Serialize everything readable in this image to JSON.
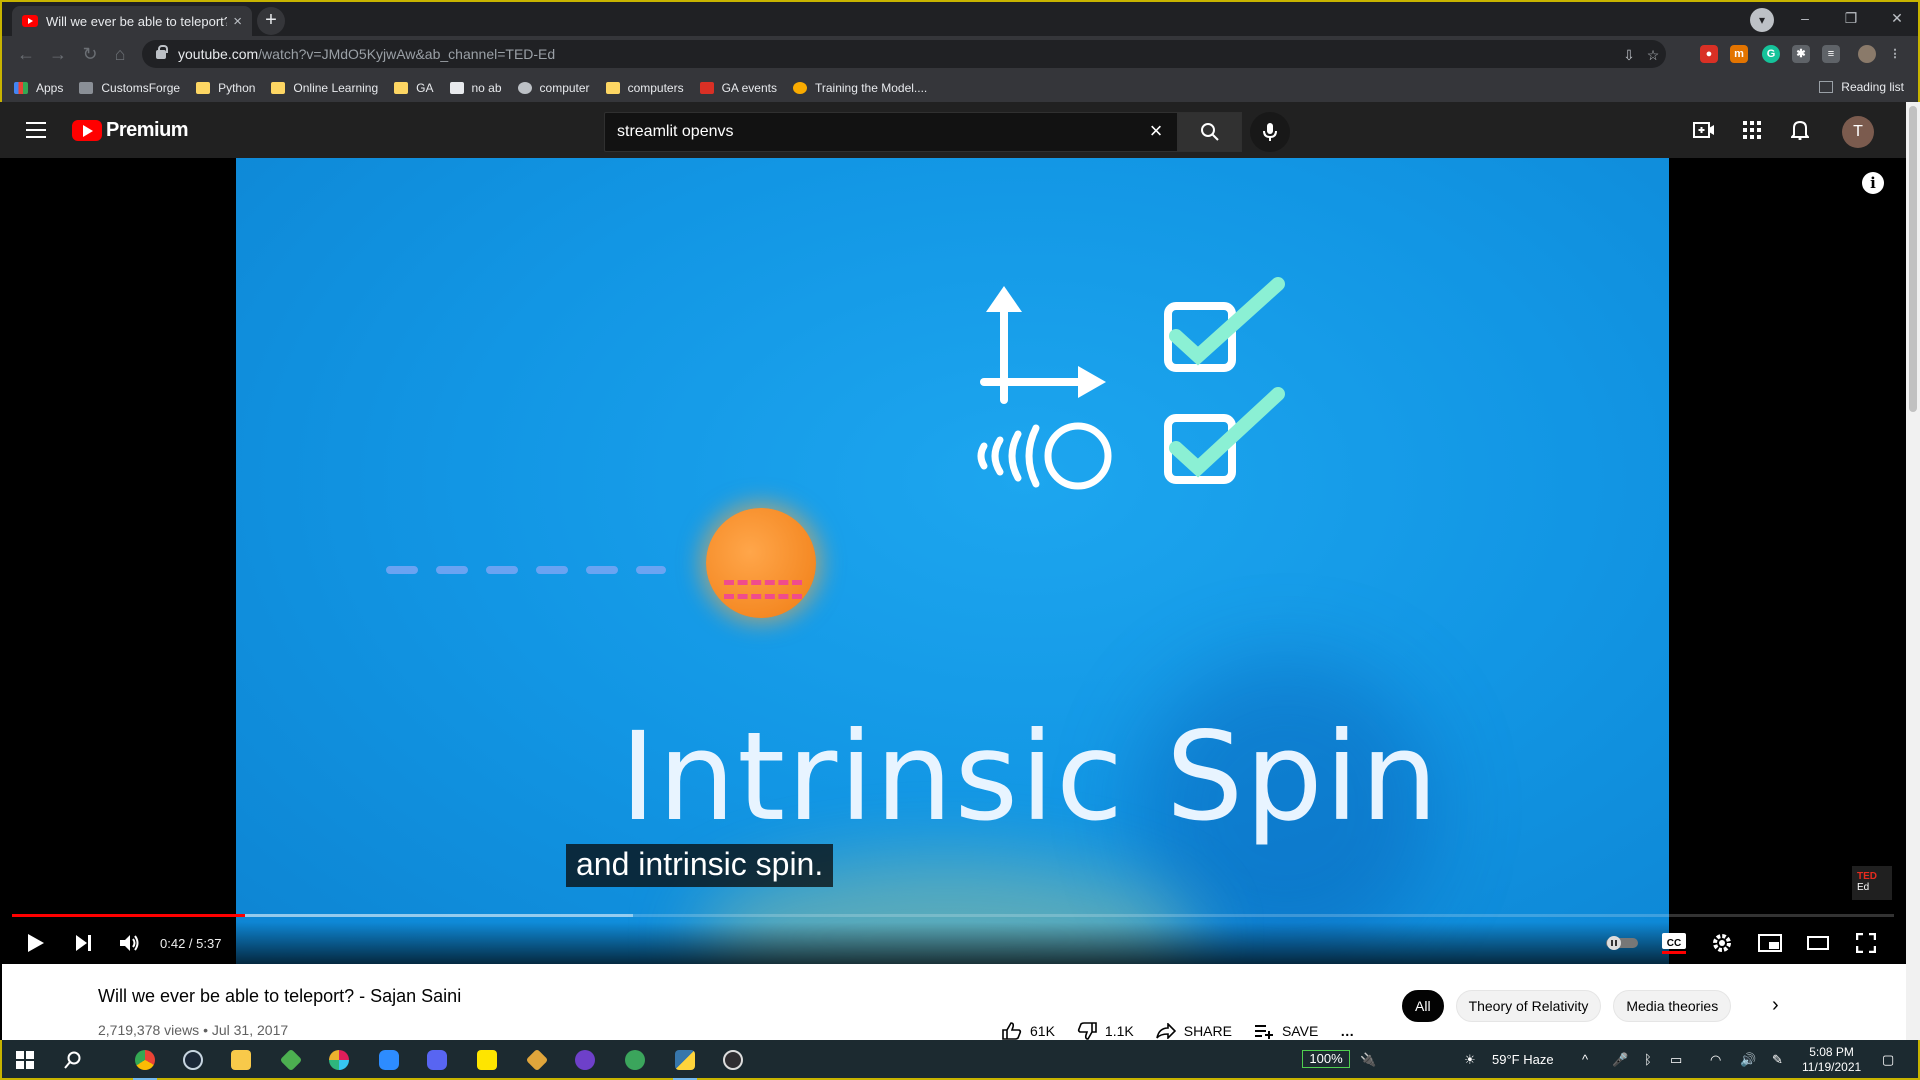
{
  "browser": {
    "tab_title": "Will we ever be able to teleport?",
    "tab_close": "×",
    "new_tab": "+",
    "url_host": "youtube.com",
    "url_path": "/watch?v=JMdO5KyjwAw&ab_channel=TED-Ed",
    "window_controls": [
      "–",
      "❐",
      "✕"
    ],
    "bookmarks": [
      {
        "label": "Apps",
        "icon": "apps-grid-icon"
      },
      {
        "label": "CustomsForge",
        "icon": "customsforge-icon"
      },
      {
        "label": "Python",
        "icon": "folder-icon"
      },
      {
        "label": "Online Learning",
        "icon": "folder-icon"
      },
      {
        "label": "GA",
        "icon": "folder-icon"
      },
      {
        "label": "no ab",
        "icon": "page-icon"
      },
      {
        "label": "computer",
        "icon": "gear-icon"
      },
      {
        "label": "computers",
        "icon": "folder-icon"
      },
      {
        "label": "GA events",
        "icon": "calendar-icon"
      },
      {
        "label": "Training the Model....",
        "icon": "link-icon"
      }
    ],
    "reading_list": "Reading list"
  },
  "youtube": {
    "brand": "Premium",
    "search_value": "streamlit openvs",
    "avatar_letter": "T"
  },
  "player": {
    "caption": "and intrinsic spin.",
    "video_text": "Intrinsic Spin",
    "time": "0:42 / 5:37",
    "played_fraction": 0.124,
    "loaded_fraction": 0.33,
    "ted_logo_top": "TED",
    "ted_logo_bottom": "Ed",
    "info": "i"
  },
  "video_info": {
    "title": "Will we ever be able to teleport? - Sajan Saini",
    "meta": "2,719,378 views • Jul 31, 2017",
    "likes": "61K",
    "dislikes": "1.1K",
    "share": "SHARE",
    "save": "SAVE",
    "more": "…"
  },
  "chips": [
    "All",
    "Theory of Relativity",
    "Media theories"
  ],
  "taskbar": {
    "battery": "100%",
    "weather": "59°F  Haze",
    "time": "5:08 PM",
    "date": "11/19/2021"
  },
  "colors": {
    "accent_red": "#ff0000",
    "video_blue": "#1296e4",
    "chrome_dark": "#202124"
  }
}
